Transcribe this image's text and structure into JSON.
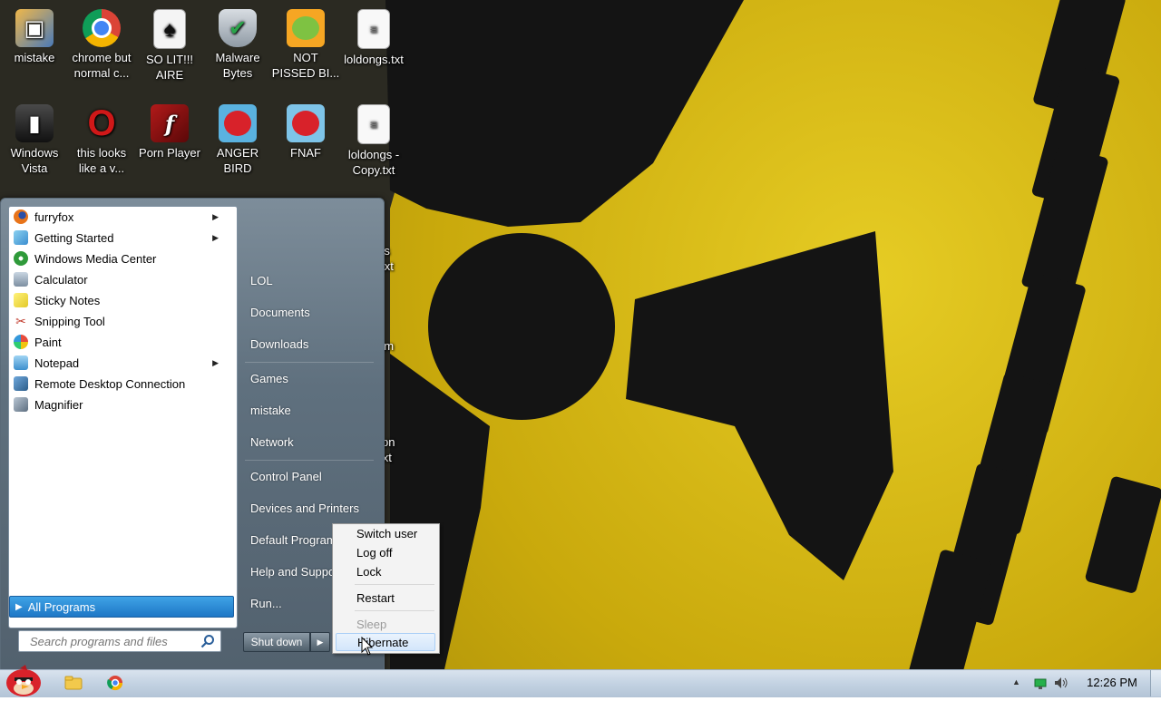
{
  "desktop": {
    "icons": [
      {
        "label": "mistake",
        "icon": "network-computer-icon"
      },
      {
        "label": "chrome but normal c...",
        "icon": "chrome-icon"
      },
      {
        "label": "SO LIT!!! AIRE",
        "icon": "cards-icon"
      },
      {
        "label": "Malware Bytes",
        "icon": "shield-icon"
      },
      {
        "label": "NOT PISSED BI...",
        "icon": "green-pig-icon"
      },
      {
        "label": "loldongs.txt",
        "icon": "text-file-icon"
      },
      {
        "label": "Windows Vista",
        "icon": "trash-bin-icon"
      },
      {
        "label": "this looks like a v...",
        "icon": "opera-icon"
      },
      {
        "label": "Porn Player",
        "icon": "flash-icon"
      },
      {
        "label": "ANGER BIRD",
        "icon": "red-bird-icon"
      },
      {
        "label": "FNAF",
        "icon": "red-bird-icon"
      },
      {
        "label": "loldongs - Copy.txt",
        "icon": "text-file-icon"
      }
    ],
    "partial_labels": [
      "gs",
      ").txt",
      "am",
      "vpn",
      "txt"
    ]
  },
  "start_menu": {
    "programs": [
      {
        "label": "furryfox",
        "icon": "firefox-icon",
        "has_submenu": true
      },
      {
        "label": "Getting Started",
        "icon": "getting-started-icon",
        "has_submenu": true
      },
      {
        "label": "Windows Media Center",
        "icon": "media-center-icon",
        "has_submenu": false
      },
      {
        "label": "Calculator",
        "icon": "calculator-icon",
        "has_submenu": false
      },
      {
        "label": "Sticky Notes",
        "icon": "sticky-notes-icon",
        "has_submenu": false
      },
      {
        "label": "Snipping Tool",
        "icon": "scissors-icon",
        "has_submenu": false
      },
      {
        "label": "Paint",
        "icon": "paint-icon",
        "has_submenu": false
      },
      {
        "label": "Notepad",
        "icon": "notepad-icon",
        "has_submenu": true
      },
      {
        "label": "Remote Desktop Connection",
        "icon": "remote-desktop-icon",
        "has_submenu": false
      },
      {
        "label": "Magnifier",
        "icon": "magnifier-icon",
        "has_submenu": false
      }
    ],
    "all_programs_label": "All Programs",
    "search_placeholder": "Search programs and files",
    "right_links": [
      "LOL",
      "Documents",
      "Downloads",
      "Games",
      "mistake",
      "Network",
      "Control Panel",
      "Devices and Printers",
      "Default Programs",
      "Help and Support",
      "Run..."
    ],
    "shutdown_label": "Shut down"
  },
  "power_menu": {
    "items": [
      {
        "label": "Switch user",
        "enabled": true
      },
      {
        "label": "Log off",
        "enabled": true
      },
      {
        "label": "Lock",
        "enabled": true
      },
      {
        "label": "Restart",
        "enabled": true
      },
      {
        "label": "Sleep",
        "enabled": false
      },
      {
        "label": "Hibernate",
        "enabled": true,
        "hovered": true
      }
    ]
  },
  "taskbar": {
    "pinned": [
      "angry-bird-start-orb-icon",
      "explorer-folder-icon",
      "chrome-icon"
    ],
    "tray": [
      "show-hidden-icons-arrow",
      "network-icon",
      "volume-icon"
    ],
    "clock": "12:26 PM"
  },
  "colors": {
    "wallpaper_yellow": "#d8bb16",
    "wallpaper_black": "#141414",
    "selection_blue": "#1e77c6"
  }
}
